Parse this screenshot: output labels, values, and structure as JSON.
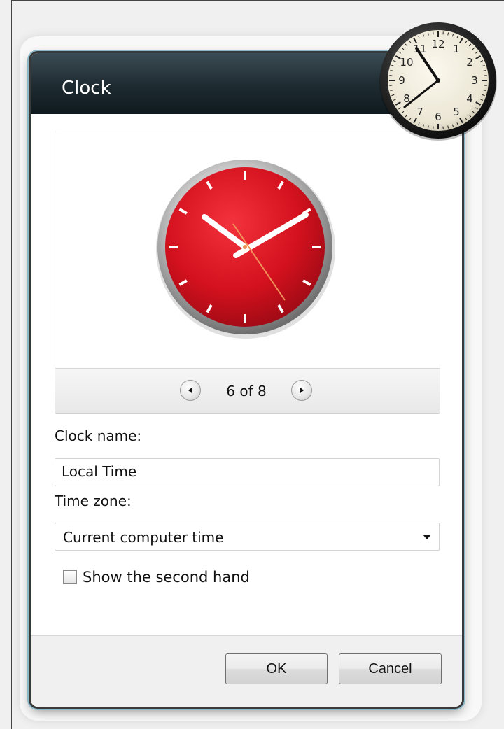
{
  "dialog": {
    "title": "Clock"
  },
  "preview": {
    "pager_label": "6 of 8",
    "prev_icon": "chevron-left-icon",
    "next_icon": "chevron-right-icon",
    "clock_face_color": "#d4111e"
  },
  "form": {
    "clock_name_label": "Clock name:",
    "clock_name_value": "Local Time",
    "time_zone_label": "Time zone:",
    "time_zone_value": "Current computer time",
    "second_hand_label": "Show the second hand",
    "second_hand_checked": false
  },
  "buttons": {
    "ok": "OK",
    "cancel": "Cancel"
  },
  "gadget": {
    "numerals": [
      "12",
      "1",
      "2",
      "3",
      "4",
      "5",
      "6",
      "7",
      "8",
      "9",
      "10",
      "11"
    ]
  }
}
